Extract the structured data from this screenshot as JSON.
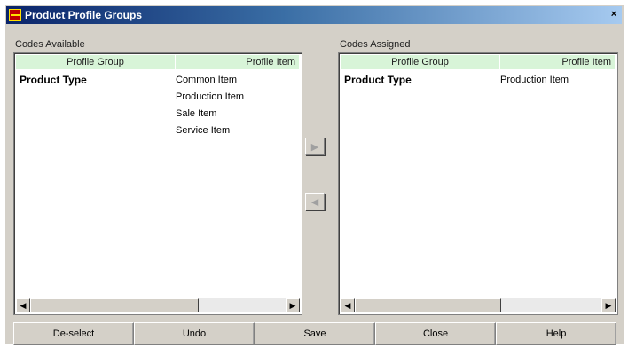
{
  "window": {
    "title": "Product Profile Groups",
    "close_glyph": "×"
  },
  "available": {
    "label": "Codes Available",
    "headers": {
      "group": "Profile Group",
      "item": "Profile Item"
    },
    "rows": [
      {
        "group": "Product Type",
        "item": "Common Item"
      },
      {
        "group": "",
        "item": "Production Item"
      },
      {
        "group": "",
        "item": "Sale Item"
      },
      {
        "group": "",
        "item": "Service Item"
      }
    ]
  },
  "assigned": {
    "label": "Codes Assigned",
    "headers": {
      "group": "Profile Group",
      "item": "Profile Item"
    },
    "rows": [
      {
        "group": "Product Type",
        "item": "Production Item"
      }
    ]
  },
  "transfer": {
    "assign_glyph": "▶",
    "unassign_glyph": "◀"
  },
  "buttons": {
    "deselect": "De-select",
    "undo": "Undo",
    "save": "Save",
    "close": "Close",
    "help": "Help"
  },
  "scroll": {
    "left_glyph": "◀",
    "right_glyph": "▶"
  }
}
